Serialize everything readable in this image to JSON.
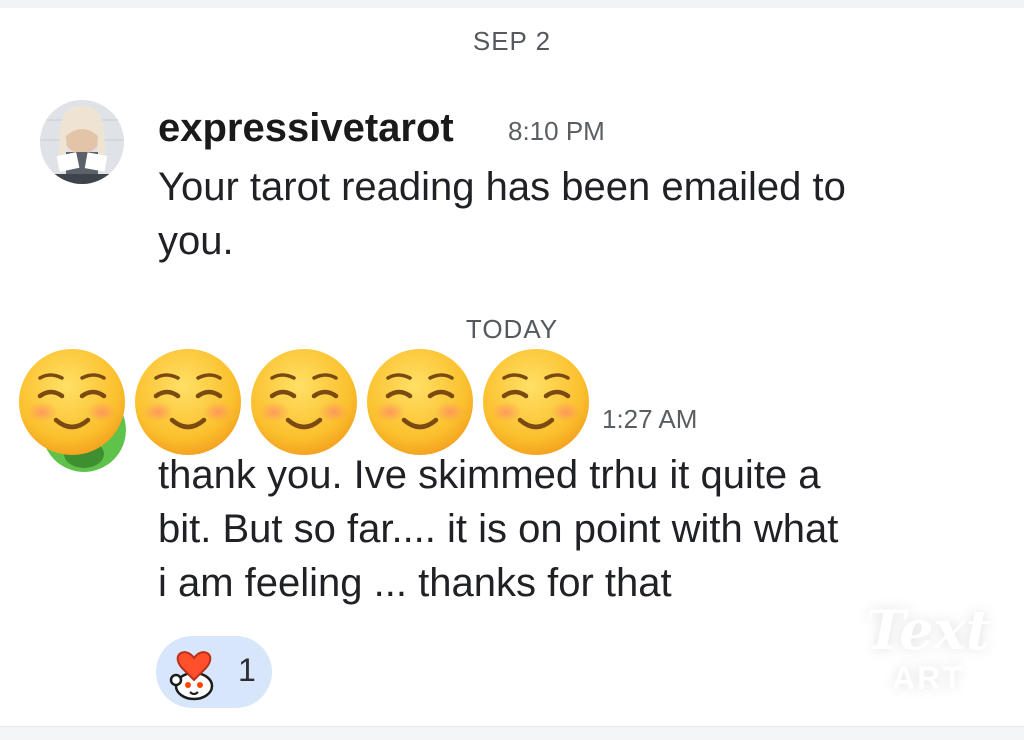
{
  "separators": {
    "first": "SEP 2",
    "second": "TODAY"
  },
  "messages": [
    {
      "username": "expressivetarot",
      "time": "8:10 PM",
      "lines": [
        "Your tarot reading has been emailed to",
        "you."
      ]
    },
    {
      "username": "",
      "time": "1:27 AM",
      "lines": [
        "thank you. Ive skimmed trhu it quite a",
        "bit. But so far.... it is on point with what",
        "i am feeling ... thanks for that"
      ]
    }
  ],
  "reaction": {
    "icon": "heart-snoo-reaction-icon",
    "count": "1"
  },
  "overlay": {
    "emoji": "smiling-face-emoji",
    "emoji_count": 5
  },
  "watermark": {
    "line1": "Text",
    "line2": "ART"
  },
  "colors": {
    "reaction_bg": "#d8e6fb",
    "timestamp": "#5a5e63",
    "separator": "#55595e"
  }
}
